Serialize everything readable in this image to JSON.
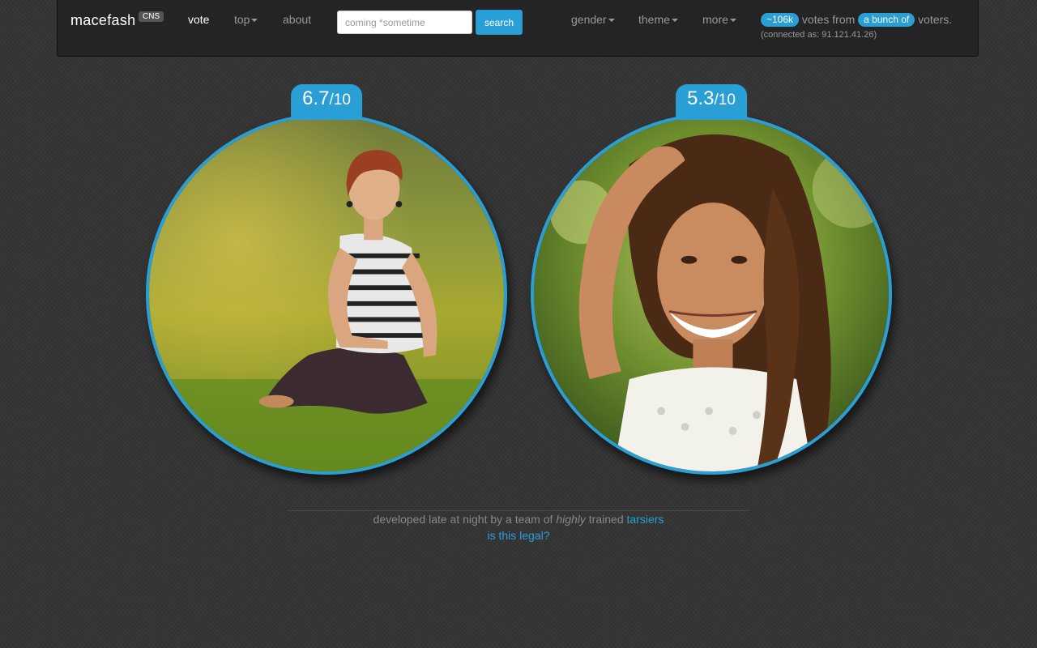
{
  "nav": {
    "brand": "macefash",
    "badge": "CNS",
    "items": {
      "vote": "vote",
      "top": "top",
      "about": "about",
      "gender": "gender",
      "theme": "theme",
      "more": "more"
    },
    "search": {
      "placeholder": "coming *sometime",
      "value": "",
      "button": "search"
    },
    "stats": {
      "votes": "~106k",
      "votes_from": "votes from",
      "voters": "a bunch of",
      "voters_suffix": "voters.",
      "connected": "(connected as: 91.121.41.26)"
    }
  },
  "candidates": [
    {
      "score": "6.7",
      "out_of": "/10",
      "photo_icon": "photo-woman-sitting-in-grass"
    },
    {
      "score": "5.3",
      "out_of": "/10",
      "photo_icon": "photo-smiling-woman-long-hair"
    }
  ],
  "footer": {
    "text_before": "developed late at night by a team of",
    "emphasis": "highly",
    "text_after": "trained",
    "link": "tarsiers",
    "legal_link": "is this legal?"
  },
  "colors": {
    "accent": "#2a9fd6",
    "navbar": "#242424",
    "background": "#353535"
  }
}
